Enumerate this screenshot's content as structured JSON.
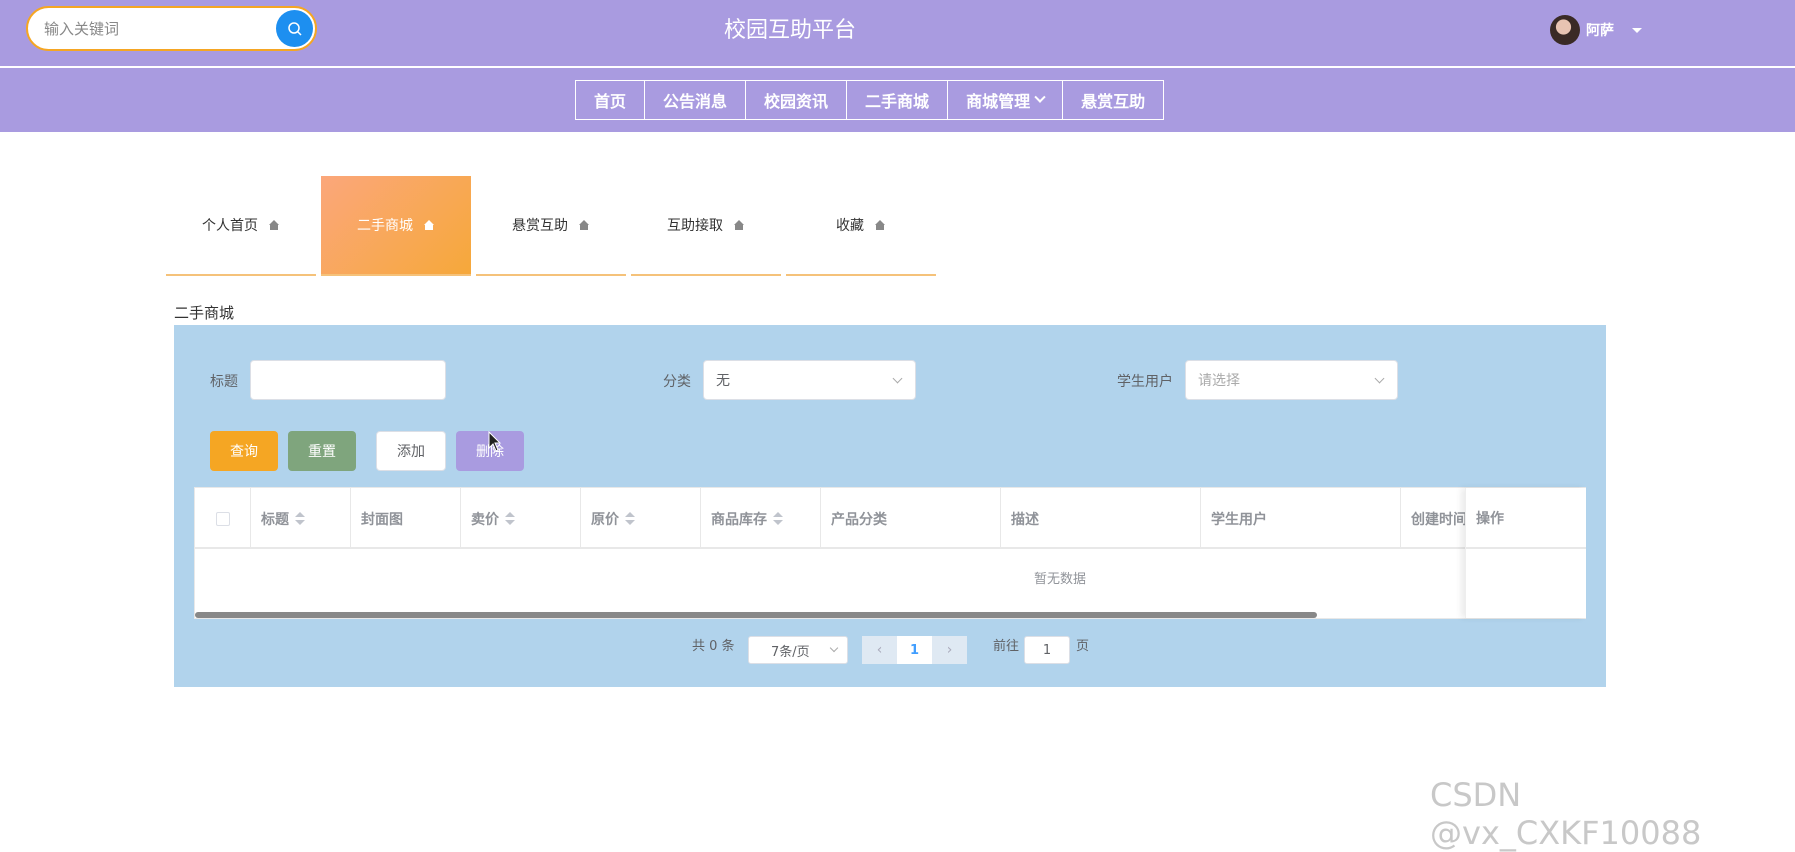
{
  "header": {
    "search_placeholder": "输入关键词",
    "site_title": "校园互助平台",
    "user_name": "阿萨",
    "nav": [
      "首页",
      "公告消息",
      "校园资讯",
      "二手商城",
      "商城管理",
      "悬赏互助"
    ]
  },
  "tabs": [
    {
      "label": "个人首页",
      "active": false
    },
    {
      "label": "二手商城",
      "active": true
    },
    {
      "label": "悬赏互助",
      "active": false
    },
    {
      "label": "互助接取",
      "active": false
    },
    {
      "label": "收藏",
      "active": false
    }
  ],
  "section_title": "二手商城",
  "filters": {
    "title_label": "标题",
    "title_value": "",
    "category_label": "分类",
    "category_value": "无",
    "student_label": "学生用户",
    "student_placeholder": "请选择"
  },
  "buttons": {
    "query": "查询",
    "reset": "重置",
    "add": "添加",
    "delete": "删除"
  },
  "colors": {
    "header_bg": "#a99be0",
    "panel_bg": "#b1d3ec",
    "query_btn": "#f5a623",
    "reset_btn": "#7fa57d",
    "delete_btn": "#a99be0",
    "search_btn": "#1d8ff0"
  },
  "table": {
    "columns": [
      "标题",
      "封面图",
      "卖价",
      "原价",
      "商品库存",
      "产品分类",
      "描述",
      "学生用户",
      "创建时间",
      "操作"
    ],
    "empty_text": "暂无数据"
  },
  "pagination": {
    "total_text": "共 0 条",
    "page_size": "7条/页",
    "current_page": "1",
    "goto_label": "前往",
    "goto_value": "1",
    "page_suffix": "页"
  },
  "watermark": "CSDN @vx_CXKF10088"
}
